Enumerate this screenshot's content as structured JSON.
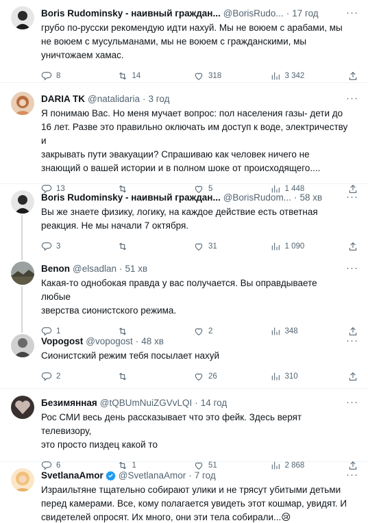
{
  "tweets": [
    {
      "name": "Boris Rudominsky - наивный граждан...",
      "handle": "@BorisRudo...",
      "time": "17 год",
      "text": "грубо по-русски рекомендую идти нахуй. Мы не воюем с арабами, мы\nне воюем с мусульманами, мы не воюем с гражданскими, мы\nуничтожаем хамас.",
      "replies": "8",
      "retweets": "14",
      "likes": "318",
      "views": "3 342",
      "avatar_color": "#1c1c1c"
    },
    {
      "name": "DARIA TK",
      "handle": "@natalidaria",
      "time": "3 год",
      "text": "Я понимаю Вас. Но меня мучает вопрос: пол населения газы- дети до\n16 лет. Разве это правильно оключать им доступ к воде, электричеству и\nзакрывать пути эвакуации? Спрашиваю как человек ничего не\nзнающий о вашей истории и в полном шоке от происходящего....",
      "replies": "13",
      "retweets": "",
      "likes": "5",
      "views": "1 448",
      "avatar_color": "#c98a63"
    },
    {
      "name": "Boris Rudominsky - наивный граждан...",
      "handle": "@BorisRudom...",
      "time": "58 хв",
      "text": "Вы же знаете физику, логику, на каждое действие есть ответная\nреакция. Не мы начали 7 октября.",
      "replies": "3",
      "retweets": "",
      "likes": "31",
      "views": "1 090",
      "avatar_color": "#1c1c1c"
    },
    {
      "name": "Benon",
      "handle": "@elsadlan",
      "time": "51 хв",
      "text": "Какая-то однобокая правда у вас получается. Вы оправдываете любые\nзверства сионистского режима.",
      "replies": "1",
      "retweets": "",
      "likes": "2",
      "views": "348",
      "avatar_color": "#6d6a5a"
    },
    {
      "name": "Vopogost",
      "handle": "@vopogost",
      "time": "48 хв",
      "text": "Сионистский режим тебя посылает нахуй",
      "replies": "2",
      "retweets": "",
      "likes": "26",
      "views": "310",
      "avatar_color": "#8a8a8a"
    },
    {
      "name": "Безимянная",
      "handle": "@tQBUmNuiZGVvLQI",
      "time": "14 год",
      "text": "Рос СМИ весь день рассказывает что это фейк. Здесь верят телевизору,\nэто просто пиздец какой то",
      "replies": "6",
      "retweets": "1",
      "likes": "51",
      "views": "2 868",
      "avatar_color": "#4a3a3a"
    },
    {
      "name": "SvetlanaAmor",
      "handle": "@SvetlanaAmor",
      "time": "7 год",
      "text": "Израильтяне тщательно собирают улики и не трясут убитыми детьми\nперед камерами. Все, кому полагается увидеть этот кошмар, увидят. И\nсвидетелей опросят. Их много, они эти тела собирали...😢",
      "replies": "",
      "retweets": "",
      "likes": "",
      "views": "",
      "avatar_color": "#f0c27a"
    }
  ],
  "icons": {
    "reply": "reply-icon",
    "retweet": "retweet-icon",
    "like": "like-icon",
    "views": "views-icon",
    "share": "share-icon",
    "more": "more-icon",
    "verified": "verified-badge-icon"
  },
  "colors": {
    "text": "#0f1419",
    "secondary": "#536471",
    "divider": "#eff3f4",
    "thread": "#cfd9de",
    "verified": "#1d9bf0"
  },
  "ui": {
    "more_glyph": "···"
  }
}
